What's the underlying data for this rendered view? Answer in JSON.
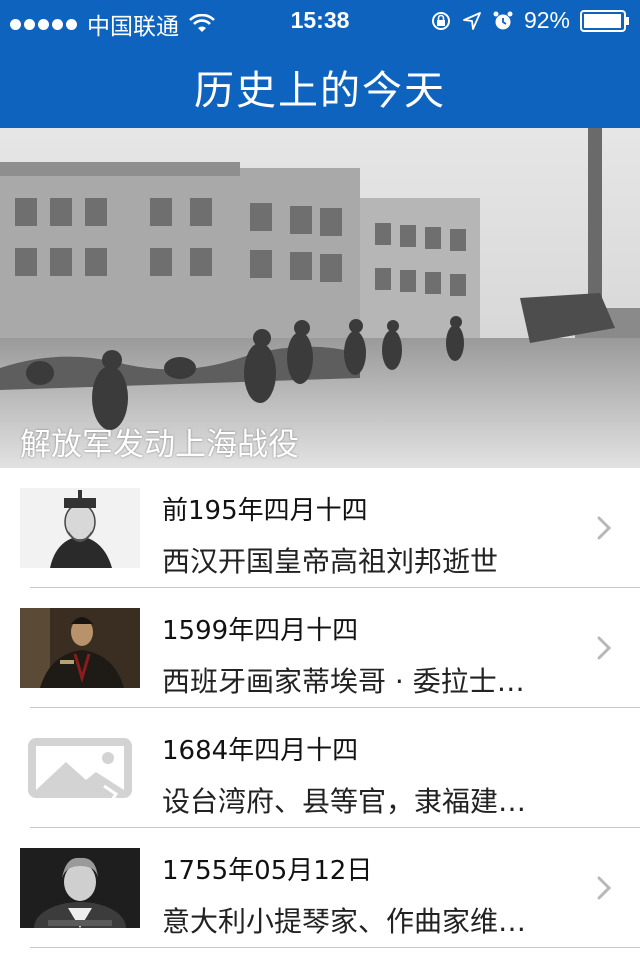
{
  "status_bar": {
    "carrier": "中国联通",
    "time": "15:38",
    "battery": "92%"
  },
  "nav": {
    "title": "历史上的今天"
  },
  "banner": {
    "caption": "解放军发动上海战役"
  },
  "events": [
    {
      "date": "前195年四月十四",
      "desc": "西汉开国皇帝高祖刘邦逝世",
      "thumb": "portrait-liu-bang"
    },
    {
      "date": "1599年四月十四",
      "desc": "西班牙画家蒂埃哥 · 委拉士…",
      "thumb": "portrait-painter"
    },
    {
      "date": "1684年四月十四",
      "desc": "设台湾府、县等官，隶福建…",
      "thumb": "placeholder-image-icon"
    },
    {
      "date": "1755年05月12日",
      "desc": "意大利小提琴家、作曲家维…",
      "thumb": "portrait-violinist"
    }
  ],
  "colors": {
    "accent": "#0e63bf"
  }
}
